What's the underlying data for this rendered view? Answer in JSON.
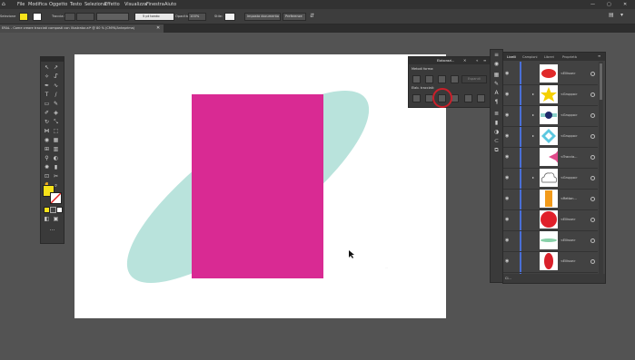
{
  "menu": [
    "File",
    "Modifica",
    "Oggetto",
    "Testo",
    "Seleziona",
    "Effetto",
    "Visualizza",
    "Finestra",
    "Aiuto"
  ],
  "control_bar": {
    "selection_label": "Selezione",
    "stroke_label": "Traccia:",
    "brush_label": "5 pt tondo",
    "opacity_label": "Opacità:",
    "opacity_value": "100%",
    "style_label": "Stile:",
    "document_setup": "Imposta documento",
    "preferences": "Preferenze",
    "fill_color": "#f7e21a"
  },
  "doc_tab": {
    "title": "ERAL - Come creare tracciati composti con Illustrator.ai* @ 80 % (CMYK/Anteprima)"
  },
  "pathfinder": {
    "tab": "Elaborazi...",
    "shape_modes": "Metodi forma:",
    "expand": "Espandi",
    "pathfinders_label": "Elab. tracciati:"
  },
  "layers_panel": {
    "tabs": [
      "Livelli",
      "Campioni",
      "Libreri",
      "Proprietà"
    ],
    "footer": "Cl...",
    "rows": [
      {
        "name": "<Ellisse>",
        "shape": "ellipse-red"
      },
      {
        "name": "<Gruppo>",
        "shape": "star-yellow"
      },
      {
        "name": "<Gruppo>",
        "shape": "band-teal"
      },
      {
        "name": "<Gruppo>",
        "shape": "diamond-cyan"
      },
      {
        "name": "<Traccia...",
        "shape": "circle-pink"
      },
      {
        "name": "<Gruppo>",
        "shape": "cloud"
      },
      {
        "name": "<Rettan...",
        "shape": "rect-orange"
      },
      {
        "name": "<Ellisse>",
        "shape": "circle-red"
      },
      {
        "name": "<Ellisse>",
        "shape": "leaf-green"
      },
      {
        "name": "<Ellisse>",
        "shape": "ellipse-red-vertical"
      }
    ]
  },
  "canvas": {
    "rect_color": "#d92a93",
    "ellipse_color": "#b9e3dc",
    "highlight_color": "#cc1f2a"
  }
}
